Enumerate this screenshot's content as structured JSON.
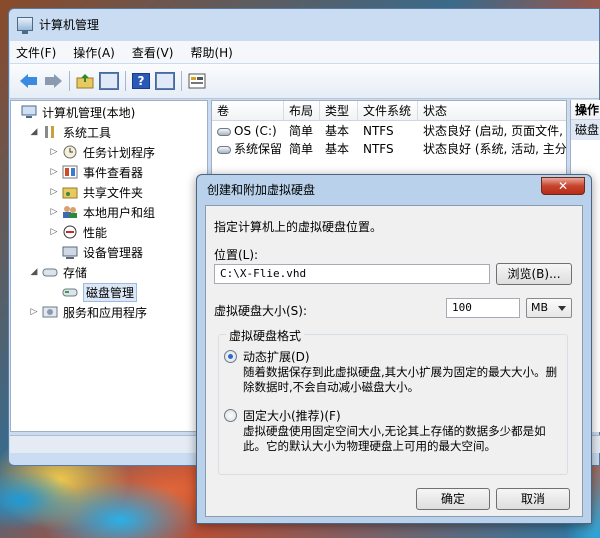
{
  "window": {
    "title": "计算机管理"
  },
  "menu": [
    "文件(F)",
    "操作(A)",
    "查看(V)",
    "帮助(H)"
  ],
  "toolbar": {
    "icons": [
      "back-arrow-icon",
      "forward-arrow-icon",
      "up-folder-icon",
      "show-hide-tree-icon",
      "help-icon",
      "properties-icon",
      "action-pane-icon"
    ],
    "help_glyph": "?"
  },
  "tree": [
    {
      "label": "计算机管理(本地)",
      "icon": "computer-icon",
      "level": 0,
      "twisty": ""
    },
    {
      "label": "系统工具",
      "icon": "tools-icon",
      "level": 1,
      "twisty": "◢"
    },
    {
      "label": "任务计划程序",
      "icon": "clock-icon",
      "level": 2,
      "twisty": "▷"
    },
    {
      "label": "事件查看器",
      "icon": "event-viewer-icon",
      "level": 2,
      "twisty": "▷"
    },
    {
      "label": "共享文件夹",
      "icon": "shared-folder-icon",
      "level": 2,
      "twisty": "▷"
    },
    {
      "label": "本地用户和组",
      "icon": "users-icon",
      "level": 2,
      "twisty": "▷"
    },
    {
      "label": "性能",
      "icon": "performance-icon",
      "level": 2,
      "twisty": "▷"
    },
    {
      "label": "设备管理器",
      "icon": "device-manager-icon",
      "level": 2,
      "twisty": ""
    },
    {
      "label": "存储",
      "icon": "storage-icon",
      "level": 1,
      "twisty": "◢"
    },
    {
      "label": "磁盘管理",
      "icon": "disk-management-icon",
      "level": 2,
      "twisty": "",
      "selected": true
    },
    {
      "label": "服务和应用程序",
      "icon": "services-icon",
      "level": 1,
      "twisty": "▷"
    }
  ],
  "list": {
    "columns": [
      "卷",
      "布局",
      "类型",
      "文件系统",
      "状态"
    ],
    "rows": [
      [
        "OS (C:)",
        "简单",
        "基本",
        "NTFS",
        "状态良好 (启动, 页面文件, "
      ],
      [
        "系统保留",
        "简单",
        "基本",
        "NTFS",
        "状态良好 (系统, 活动, 主分"
      ]
    ]
  },
  "actions": {
    "header": "操作",
    "item": "磁盘"
  },
  "dialog": {
    "title": "创建和附加虚拟硬盘",
    "close_glyph": "✕",
    "intro": "指定计算机上的虚拟硬盘位置。",
    "location_label": "位置(L):",
    "location_value": "C:\\X-Flie.vhd",
    "browse_button": "浏览(B)...",
    "size_label": "虚拟硬盘大小(S):",
    "size_value": "100",
    "unit": "MB",
    "format_group": "虚拟硬盘格式",
    "dynamic_label": "动态扩展(D)",
    "dynamic_desc": "随着数据保存到此虚拟硬盘,其大小扩展为固定的最大大小。删除数据时,不会自动减小磁盘大小。",
    "fixed_label": "固定大小(推荐)(F)",
    "fixed_desc": "虚拟硬盘使用固定空间大小,无论其上存储的数据多少都是如此。它的默认大小为物理硬盘上可用的最大空间。",
    "selected_format": "dynamic",
    "ok_button": "确定",
    "cancel_button": "取消"
  }
}
